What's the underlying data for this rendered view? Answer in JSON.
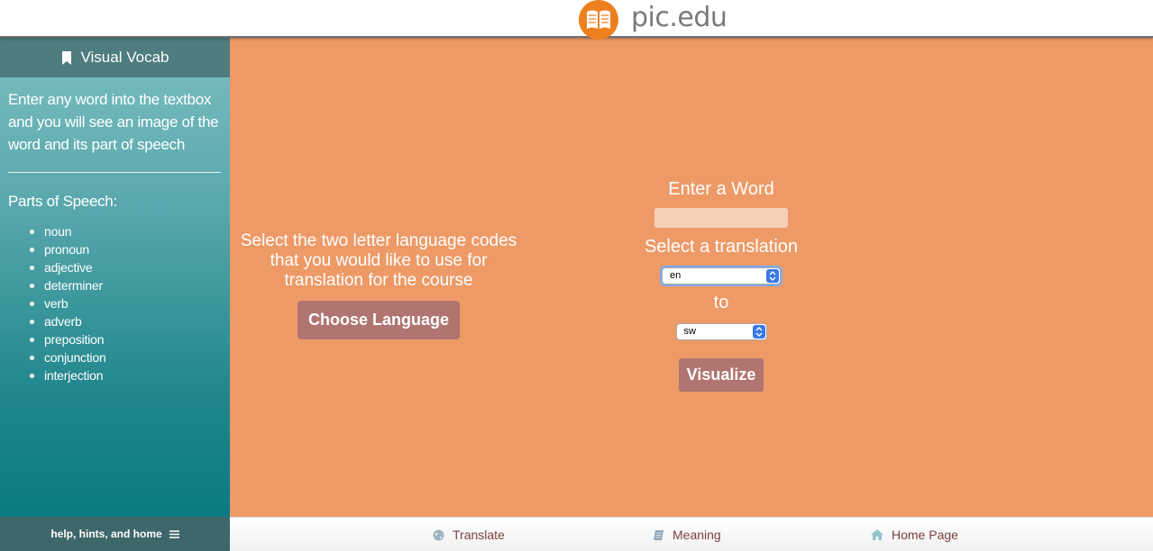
{
  "brand": {
    "name": "pic.edu",
    "logo_icon": "open-book-icon",
    "logo_color": "#ee7f1e"
  },
  "sidebar": {
    "title": "Visual Vocab",
    "title_icon": "bookmark-icon",
    "description": "Enter any word into the textbox and you will see an image of the word and its part of speech",
    "parts_title": "Parts of Speech:",
    "parts": [
      "noun",
      "pronoun",
      "adjective",
      "determiner",
      "verb",
      "adverb",
      "preposition",
      "conjunction",
      "interjection"
    ],
    "footer_label": "help, hints, and home",
    "footer_icon": "hamburger-menu-icon"
  },
  "main": {
    "language_prompt": "Select the two letter language codes that you would like to use for translation for the course",
    "choose_language_label": "Choose Language",
    "enter_word_label": "Enter a Word",
    "word_value": "",
    "select_translation_label": "Select a translation",
    "from_value": "en",
    "to_label": "to",
    "to_value": "sw",
    "visualize_label": "Visualize"
  },
  "nav": {
    "translate": {
      "label": "Translate",
      "icon": "globe-icon"
    },
    "meaning": {
      "label": "Meaning",
      "icon": "book-icon"
    },
    "home": {
      "label": "Home Page",
      "icon": "home-icon"
    }
  },
  "colors": {
    "main_bg": "#ed9a67",
    "button_bg": "#b07571",
    "sidebar_header": "#4e7c7f",
    "nav_text": "#7a4040"
  }
}
